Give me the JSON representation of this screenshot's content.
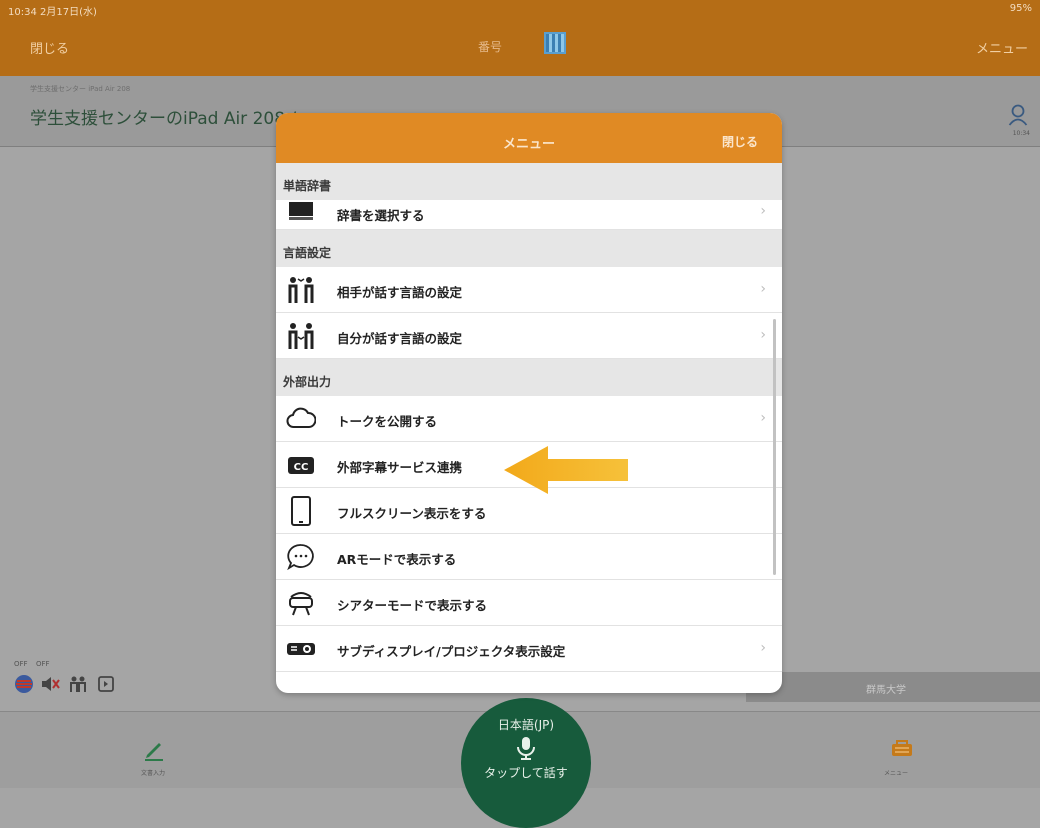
{
  "status": {
    "time": "10:34  2月17日(水)",
    "battery": "95%"
  },
  "nav": {
    "close": "閉じる",
    "title": "番号",
    "menu": "メニュー"
  },
  "room": {
    "breadcrumb": "学生支援センター  iPad Air 208",
    "title": "学生支援センターのiPad Air 208 /",
    "avatar_label": "10:34"
  },
  "left_controls": {
    "off1": "OFF",
    "off2": "OFF"
  },
  "right_bar": {
    "label": "群馬大学"
  },
  "tabs": {
    "left_label": "文書入力",
    "right_label": "メニュー"
  },
  "mic": {
    "lang": "日本語(JP)",
    "tap": "タップして話す"
  },
  "modal": {
    "title": "メニュー",
    "close": "閉じる",
    "sections": [
      {
        "header": "単語辞書",
        "items": [
          {
            "label": "辞書を選択する",
            "icon": "book-icon",
            "chevron": "›"
          }
        ]
      },
      {
        "header": "言語設定",
        "items": [
          {
            "label": "相手が話す言語の設定",
            "icon": "people-talk-icon",
            "chevron": "›"
          },
          {
            "label": "自分が話す言語の設定",
            "icon": "people-listen-icon",
            "chevron": "›"
          }
        ]
      },
      {
        "header": "外部出力",
        "items": [
          {
            "label": "トークを公開する",
            "icon": "cloud-icon",
            "chevron": "›"
          },
          {
            "label": "外部字幕サービス連携",
            "icon": "cc-icon",
            "chevron": ""
          },
          {
            "label": "フルスクリーン表示をする",
            "icon": "tablet-icon",
            "chevron": ""
          },
          {
            "label": "ARモードで表示する",
            "icon": "chat-bubble-icon",
            "chevron": ""
          },
          {
            "label": "シアターモードで表示する",
            "icon": "vr-headset-icon",
            "chevron": ""
          },
          {
            "label": "サブディスプレイ/プロジェクタ表示設定",
            "icon": "projector-icon",
            "chevron": "›"
          }
        ]
      }
    ]
  },
  "colors": {
    "brand_orange": "#e08a24",
    "nav_orange": "#b56d16",
    "mic_green": "#175b3c",
    "arrow": "#f2a91a"
  }
}
